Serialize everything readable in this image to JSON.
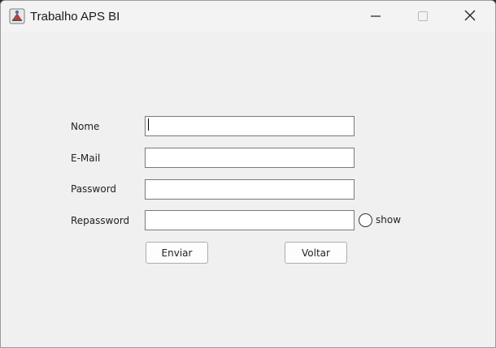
{
  "window": {
    "title": "Trabalho APS BI",
    "app_icon": "java-app-icon",
    "controls": [
      "minimize-icon",
      "maximize-icon",
      "close-icon"
    ]
  },
  "form": {
    "fields": [
      {
        "label": "Nome",
        "value": "",
        "focused": true
      },
      {
        "label": "E-Mail",
        "value": ""
      },
      {
        "label": "Password",
        "value": ""
      },
      {
        "label": "Repassword",
        "value": ""
      }
    ],
    "show_toggle": {
      "label": "show",
      "checked": false
    },
    "buttons": {
      "send_label": "Enviar",
      "back_label": "Voltar"
    }
  },
  "colors": {
    "background": "#f0f0f0",
    "field_border": "#7a7a7a"
  }
}
